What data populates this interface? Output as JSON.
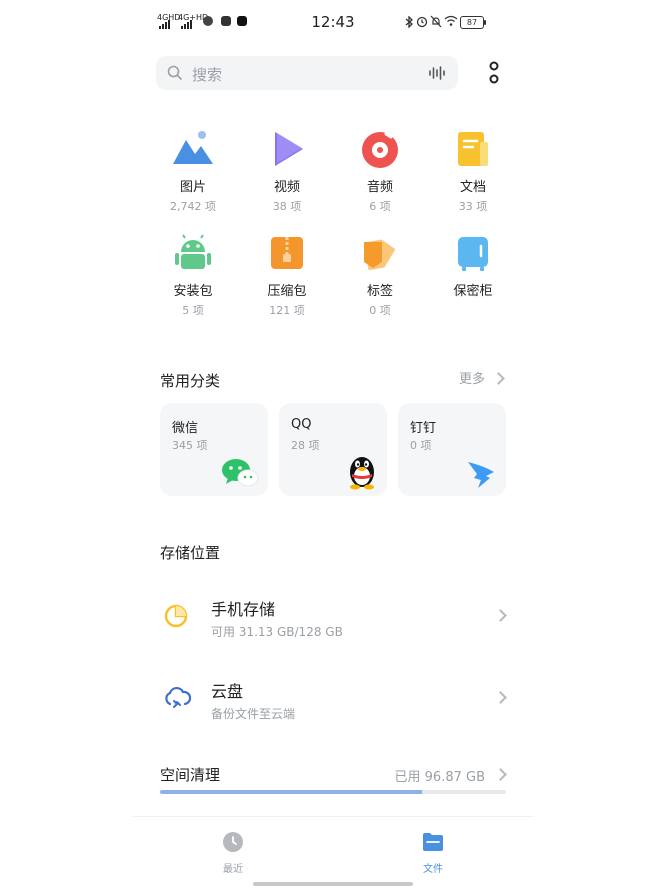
{
  "status_bar": {
    "time": "12:43",
    "signal_1": "4GHD",
    "signal_2": "4G+HD",
    "battery": "87"
  },
  "search": {
    "placeholder": "搜索"
  },
  "categories": [
    {
      "name": "图片",
      "count": "2,742 项",
      "icon": "image-icon"
    },
    {
      "name": "视频",
      "count": "38 项",
      "icon": "video-icon"
    },
    {
      "name": "音频",
      "count": "6 项",
      "icon": "music-icon"
    },
    {
      "name": "文档",
      "count": "33 项",
      "icon": "document-icon"
    },
    {
      "name": "安装包",
      "count": "5 项",
      "icon": "android-icon"
    },
    {
      "name": "压缩包",
      "count": "121 项",
      "icon": "zip-icon"
    },
    {
      "name": "标签",
      "count": "0 项",
      "icon": "tag-icon"
    },
    {
      "name": "保密柜",
      "count": "",
      "icon": "safe-icon"
    }
  ],
  "common": {
    "title": "常用分类",
    "more": "更多",
    "apps": [
      {
        "name": "微信",
        "count": "345 项",
        "icon": "wechat-icon"
      },
      {
        "name": "QQ",
        "count": "28 项",
        "icon": "qq-icon"
      },
      {
        "name": "钉钉",
        "count": "0 项",
        "icon": "dingtalk-icon"
      }
    ]
  },
  "storage": {
    "title": "存储位置",
    "items": [
      {
        "name": "手机存储",
        "sub": "可用 31.13 GB/128 GB",
        "icon": "pie-chart-icon"
      },
      {
        "name": "云盘",
        "sub": "备份文件至云端",
        "icon": "cloud-sync-icon"
      }
    ]
  },
  "cleanup": {
    "title": "空间清理",
    "used": "已用 96.87 GB",
    "used_fraction": 0.757
  },
  "nav": {
    "recent": "最近",
    "files": "文件"
  },
  "colors": {
    "accent": "#4a90e2",
    "progress": "#8fb1ea"
  }
}
